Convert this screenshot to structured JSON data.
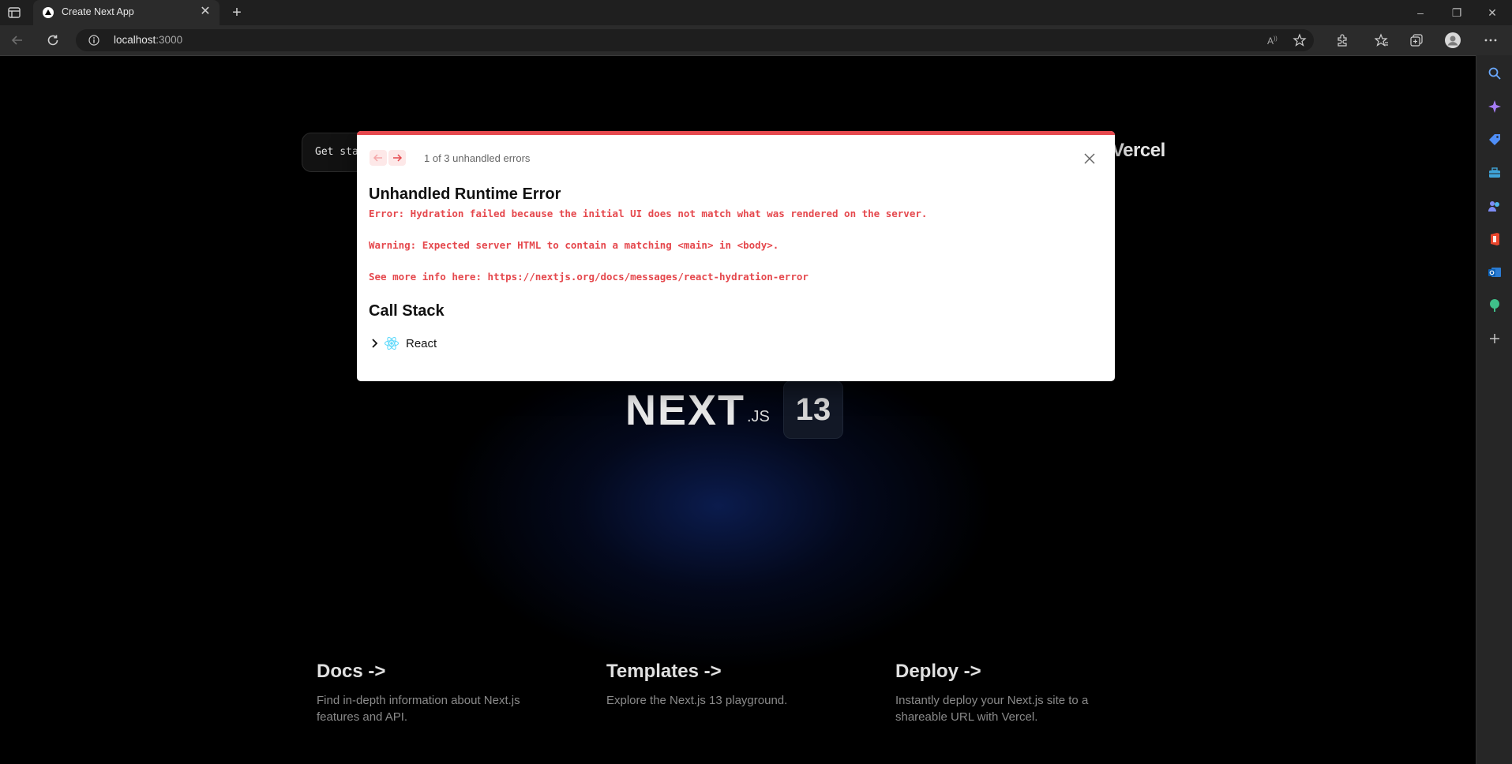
{
  "browser": {
    "tab_title": "Create Next App",
    "url_host": "localhost",
    "url_port": ":3000"
  },
  "page": {
    "get_started": "Get sta",
    "vercel": "Vercel",
    "next_logo": "NEXT",
    "next_js_suffix": ".JS",
    "version_badge": "13",
    "cards": [
      {
        "title": "Docs ->",
        "desc": "Find in-depth information about Next.js features and API."
      },
      {
        "title": "Templates ->",
        "desc": "Explore the Next.js 13 playground."
      },
      {
        "title": "Deploy ->",
        "desc": "Instantly deploy your Next.js site to a shareable URL with Vercel."
      }
    ]
  },
  "error_overlay": {
    "count": "1 of 3 unhandled errors",
    "title": "Unhandled Runtime Error",
    "line1": "Error: Hydration failed because the initial UI does not match what was rendered on the server.",
    "line2": "Warning: Expected server HTML to contain a matching <main> in <body>.",
    "line3": "See more info here: https://nextjs.org/docs/messages/react-hydration-error",
    "call_stack_title": "Call Stack",
    "stack_item": "React"
  },
  "colors": {
    "error_red": "#e5484d",
    "react_blue": "#61dafb"
  }
}
